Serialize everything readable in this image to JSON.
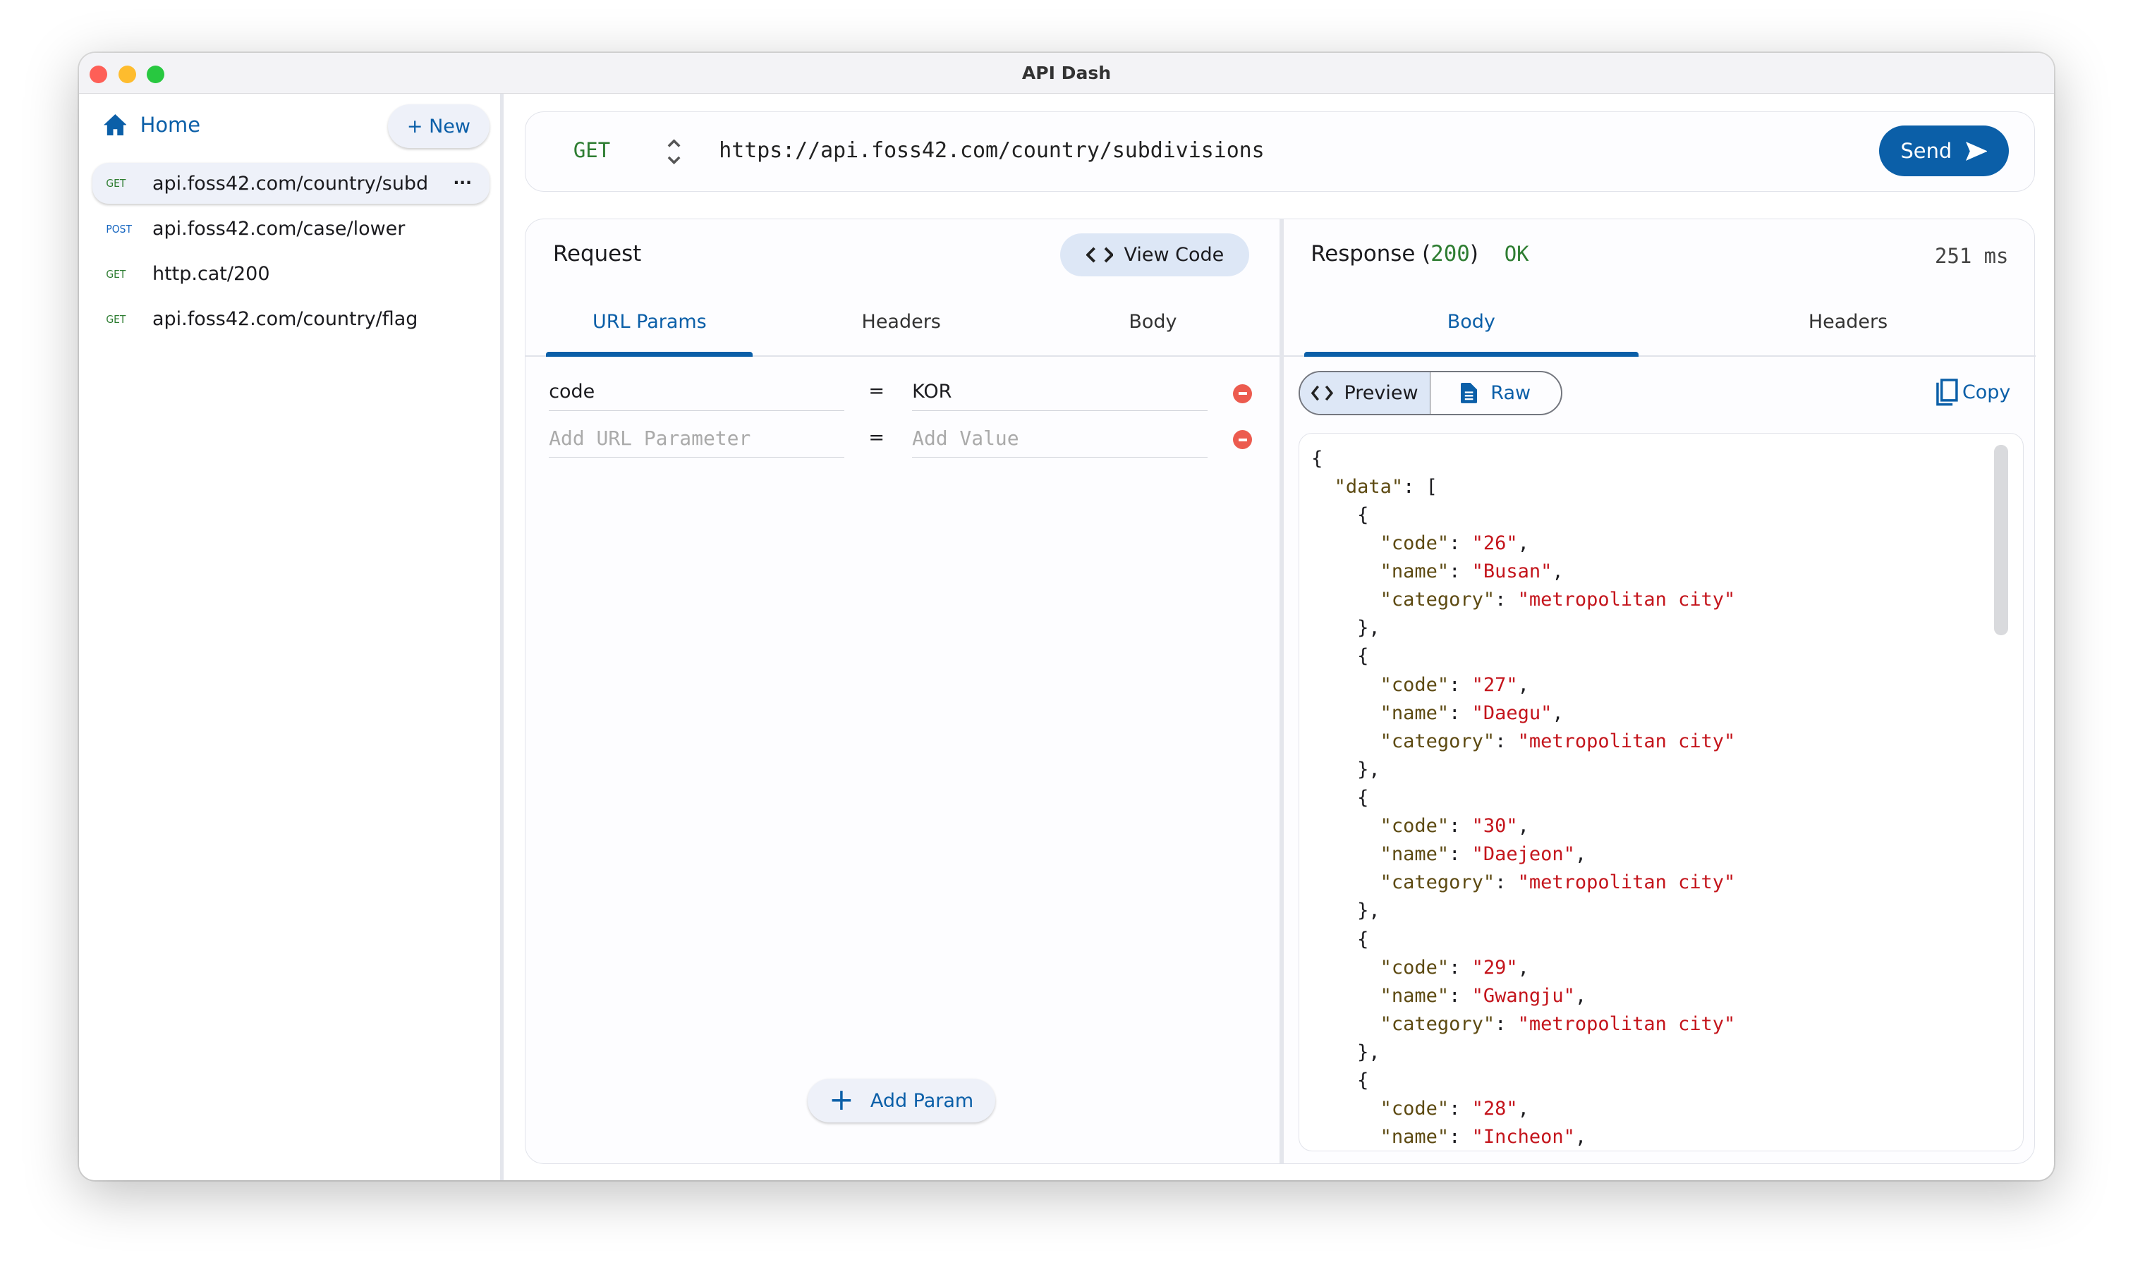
{
  "window": {
    "title": "API Dash"
  },
  "sidebar": {
    "home_label": "Home",
    "new_label": "+ New",
    "more_icon": "ellipsis-icon",
    "items": [
      {
        "method": "GET",
        "url": "api.foss42.com/country/subd",
        "selected": true
      },
      {
        "method": "POST",
        "url": "api.foss42.com/case/lower"
      },
      {
        "method": "GET",
        "url": "http.cat/200"
      },
      {
        "method": "GET",
        "url": "api.foss42.com/country/flag"
      }
    ]
  },
  "urlbar": {
    "method": "GET",
    "url": "https://api.foss42.com/country/subdivisions",
    "send_label": "Send"
  },
  "request": {
    "title": "Request",
    "view_code_label": "View Code",
    "tabs": [
      "URL Params",
      "Headers",
      "Body"
    ],
    "active_tab": "URL Params",
    "params": [
      {
        "key": "code",
        "value": "KOR"
      }
    ],
    "key_placeholder": "Add URL Parameter",
    "value_placeholder": "Add Value",
    "equals": "=",
    "add_param_label": "Add Param"
  },
  "response": {
    "title": "Response",
    "status_code": "200",
    "status_text": "OK",
    "time": "251 ms",
    "tabs": [
      "Body",
      "Headers"
    ],
    "active_tab": "Body",
    "preview_label": "Preview",
    "raw_label": "Raw",
    "copy_label": "Copy",
    "body": {
      "data": [
        {
          "code": "26",
          "name": "Busan",
          "category": "metropolitan city"
        },
        {
          "code": "27",
          "name": "Daegu",
          "category": "metropolitan city"
        },
        {
          "code": "30",
          "name": "Daejeon",
          "category": "metropolitan city"
        },
        {
          "code": "29",
          "name": "Gwangju",
          "category": "metropolitan city"
        },
        {
          "code": "28",
          "name": "Incheon"
        }
      ]
    }
  },
  "colors": {
    "accent": "#0b5fa8",
    "get": "#2e7d32",
    "post": "#1565c0",
    "error": "#ec5b4f",
    "string": "#c4151c"
  }
}
